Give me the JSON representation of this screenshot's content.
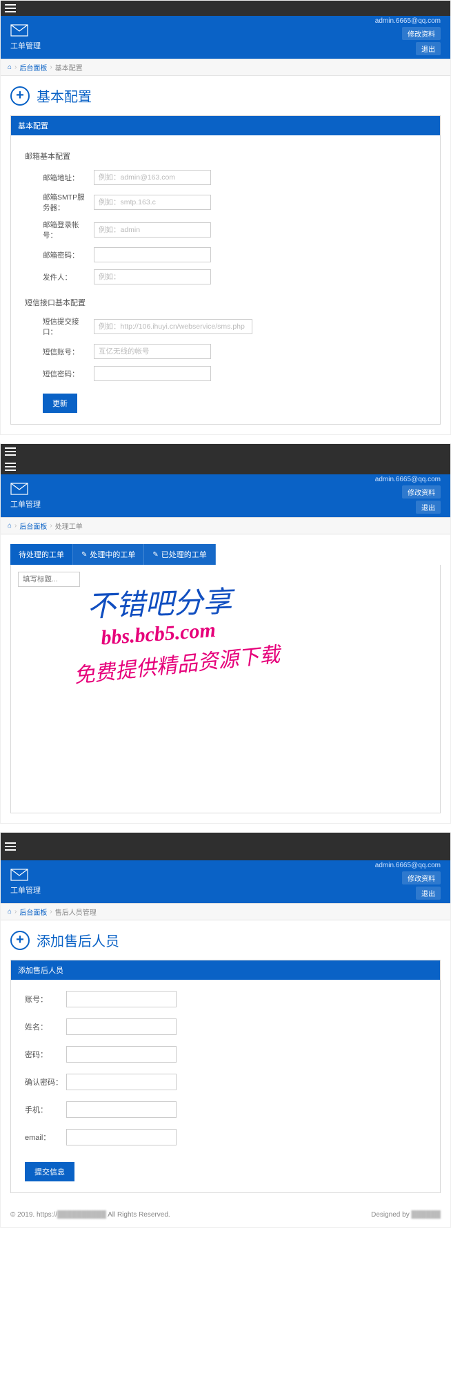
{
  "common": {
    "app_name": "工单管理",
    "user_email": "admin.6665@qq.com",
    "edit_profile": "修改资料",
    "logout": "退出",
    "bc_home": "后台面板"
  },
  "screen1": {
    "bc_current": "基本配置",
    "title": "基本配置",
    "panel_title": "基本配置",
    "sec1": "邮箱基本配置",
    "fields1": [
      {
        "label": "邮箱地址：",
        "ph": "例如：admin@163.com",
        "val": ""
      },
      {
        "label": "邮箱SMTP服务器：",
        "ph": "例如：smtp.163.c",
        "val": ""
      },
      {
        "label": "邮箱登录帐号：",
        "ph": "例如：admin",
        "val": ""
      },
      {
        "label": "邮箱密码：",
        "ph": "",
        "val": ""
      },
      {
        "label": "发件人：",
        "ph": "例如：",
        "val": ""
      }
    ],
    "sec2": "短信接口基本配置",
    "fields2": [
      {
        "label": "短信提交接口：",
        "ph": "例如：http://106.ihuyi.cn/webservice/sms.php",
        "val": ""
      },
      {
        "label": "短信账号：",
        "ph": "互亿无线的帐号",
        "val": ""
      },
      {
        "label": "短信密码：",
        "ph": "",
        "val": ""
      }
    ],
    "submit": "更新"
  },
  "screen2": {
    "bc_current": "处理工单",
    "tabs": [
      {
        "label": "待处理的工单",
        "icon": ""
      },
      {
        "label": "处理中的工单",
        "icon": "✎"
      },
      {
        "label": "已处理的工单",
        "icon": "✎"
      }
    ],
    "search_ph": "填写标题...",
    "wm1": "不错吧分享",
    "wm2": "bbs.bcb5.com",
    "wm3": "免费提供精品资源下载"
  },
  "screen3": {
    "bc_current": "售后人员管理",
    "title": "添加售后人员",
    "panel_title": "添加售后人员",
    "fields": [
      {
        "label": "账号："
      },
      {
        "label": "姓名："
      },
      {
        "label": "密码："
      },
      {
        "label": "确认密码："
      },
      {
        "label": "手机："
      },
      {
        "label": "email："
      }
    ],
    "submit": "提交信息"
  },
  "footer": {
    "left_a": "© 2019.",
    "left_b": "https://",
    "left_c": "All Rights Reserved.",
    "right_a": "Designed by"
  }
}
